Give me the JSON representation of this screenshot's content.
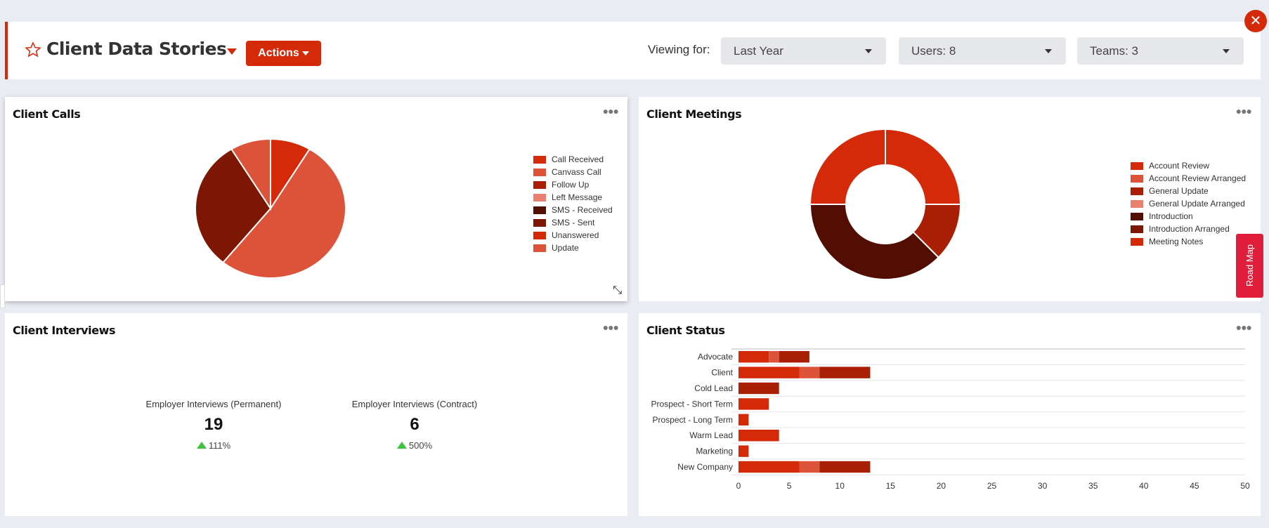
{
  "header": {
    "title": "Client Data Stories",
    "actions_label": "Actions",
    "viewing_label": "Viewing for:",
    "filters": [
      {
        "value": "Last Year"
      },
      {
        "value": "Users: 8"
      },
      {
        "value": "Teams: 3"
      }
    ],
    "close_icon": "close-icon",
    "star_icon": "star-outline-icon"
  },
  "colors": {
    "accent": "#d42a0a",
    "roadmap": "#e01e3c",
    "trend_up": "#3cc43c"
  },
  "roadmap_label": "Road Map",
  "cards": {
    "calls": {
      "title": "Client Calls"
    },
    "meetings": {
      "title": "Client Meetings"
    },
    "interviews": {
      "title": "Client Interviews",
      "kpis": [
        {
          "label": "Employer Interviews (Permanent)",
          "value": "19",
          "change": "111%",
          "trend": "up"
        },
        {
          "label": "Employer Interviews (Contract)",
          "value": "6",
          "change": "500%",
          "trend": "up"
        }
      ]
    },
    "status": {
      "title": "Client Status"
    }
  },
  "chart_data": [
    {
      "type": "pie",
      "legend": "right",
      "legend_entries": [
        {
          "name": "Call Received",
          "color": "#d42a0a"
        },
        {
          "name": "Canvass Call",
          "color": "#dd533a"
        },
        {
          "name": "Follow Up",
          "color": "#a81f05"
        },
        {
          "name": "Left Message",
          "color": "#e8806d"
        },
        {
          "name": "SMS - Received",
          "color": "#520e02"
        },
        {
          "name": "SMS - Sent",
          "color": "#7d1603"
        },
        {
          "name": "Unanswered",
          "color": "#d42a0a"
        },
        {
          "name": "Update",
          "color": "#dd533a"
        }
      ],
      "slices": [
        {
          "name": "Call Received",
          "value": 2
        },
        {
          "name": "Canvass Call",
          "value": 12
        },
        {
          "name": "SMS - Sent",
          "value": 7
        },
        {
          "name": "Update",
          "value": 2
        }
      ]
    },
    {
      "type": "pie",
      "donut": true,
      "legend": "right",
      "legend_entries": [
        {
          "name": "Account Review",
          "color": "#d42a0a"
        },
        {
          "name": "Account Review Arranged",
          "color": "#dd533a"
        },
        {
          "name": "General Update",
          "color": "#a81f05"
        },
        {
          "name": "General Update Arranged",
          "color": "#e8806d"
        },
        {
          "name": "Introduction",
          "color": "#520e02"
        },
        {
          "name": "Introduction Arranged",
          "color": "#7d1603"
        },
        {
          "name": "Meeting Notes",
          "color": "#d42a0a"
        }
      ],
      "slices": [
        {
          "name": "Account Review",
          "value": 2
        },
        {
          "name": "General Update",
          "value": 1
        },
        {
          "name": "Introduction",
          "value": 3
        },
        {
          "name": "Meeting Notes",
          "value": 2
        }
      ]
    },
    {
      "type": "bar",
      "orientation": "horizontal",
      "stacked": true,
      "grid": true,
      "categories": [
        "Advocate",
        "Client",
        "Cold Lead",
        "Prospect - Short Term",
        "Prospect - Long Term",
        "Warm Lead",
        "Marketing",
        "New Company"
      ],
      "series": [
        {
          "color": "#d42a0a",
          "values": [
            3,
            6,
            0,
            3,
            1,
            4,
            1,
            6
          ]
        },
        {
          "color": "#dd533a",
          "values": [
            1,
            2,
            0,
            0,
            0,
            0,
            0,
            2
          ]
        },
        {
          "color": "#a81f05",
          "values": [
            3,
            5,
            4,
            0,
            0,
            0,
            0,
            5
          ]
        }
      ],
      "xlim": [
        0,
        50
      ],
      "xticks": [
        0,
        5,
        10,
        15,
        20,
        25,
        30,
        35,
        40,
        45,
        50
      ]
    }
  ]
}
